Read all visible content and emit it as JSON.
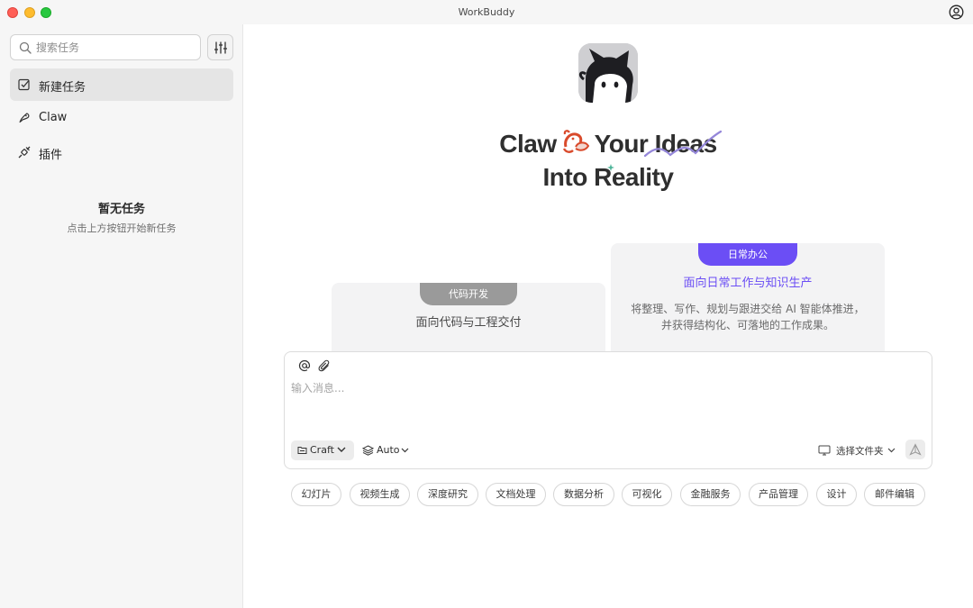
{
  "window": {
    "title": "WorkBuddy"
  },
  "sidebar": {
    "search_placeholder": "搜索任务",
    "items": [
      {
        "label": "新建任务",
        "icon": "new-task-icon",
        "active": true
      },
      {
        "label": "Claw",
        "icon": "claw-icon",
        "active": false
      },
      {
        "label": "插件",
        "icon": "plugin-icon",
        "active": false
      }
    ],
    "empty_title": "暂无任务",
    "empty_subtitle": "点击上方按钮开始新任务"
  },
  "hero": {
    "line1_word1": "Claw",
    "line1_word2": "Your Ideas",
    "line2": "Into Reality"
  },
  "cards": [
    {
      "tab": "代码开发",
      "title": "面向代码与工程交付",
      "desc": ""
    },
    {
      "tab": "日常办公",
      "title": "面向日常工作与知识生产",
      "desc": "将整理、写作、规划与跟进交给 AI 智能体推进，并获得结构化、可落地的工作成果。"
    }
  ],
  "composer": {
    "placeholder": "输入消息...",
    "mode_label": "Craft",
    "model_label": "Auto",
    "folder_label": "选择文件夹"
  },
  "chips": [
    "幻灯片",
    "视频生成",
    "深度研究",
    "文档处理",
    "数据分析",
    "可视化",
    "金融服务",
    "产品管理",
    "设计",
    "邮件编辑"
  ],
  "colors": {
    "accent": "#6b4ef5",
    "sidebar_bg": "#f6f6f6",
    "card_bg": "#f3f3f4"
  }
}
